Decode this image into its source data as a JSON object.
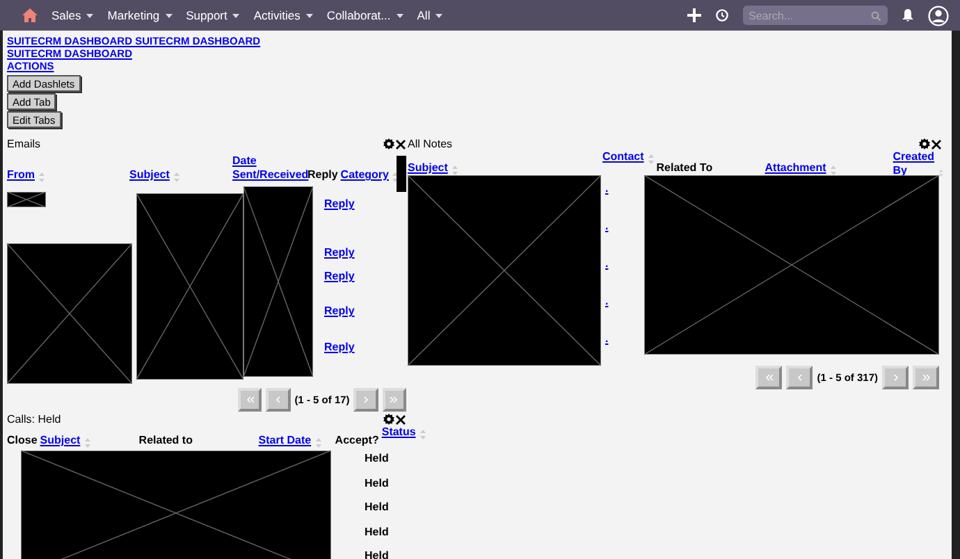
{
  "nav": {
    "items": [
      {
        "label": "Sales"
      },
      {
        "label": "Marketing"
      },
      {
        "label": "Support"
      },
      {
        "label": "Activities"
      },
      {
        "label": "Collaborat..."
      },
      {
        "label": "All"
      }
    ],
    "search": {
      "placeholder": "Search..."
    }
  },
  "breadcrumbs": [
    "SUITECRM DASHBOARD SUITECRM DASHBOARD",
    "SUITECRM DASHBOARD",
    "ACTIONS"
  ],
  "buttons": [
    "Add Dashlets",
    "Add Tab",
    "Edit Tabs"
  ],
  "emails": {
    "title": "Emails",
    "columns": [
      {
        "label": "From",
        "kind": "link"
      },
      {
        "label": "Subject",
        "kind": "link"
      },
      {
        "label": "Date Sent/Received",
        "kind": "link"
      },
      {
        "label": "Reply",
        "kind": "plain"
      },
      {
        "label": "Category",
        "kind": "link"
      }
    ],
    "rows": [
      {
        "reply": "Reply"
      },
      {
        "reply": "Reply"
      },
      {
        "reply": "Reply"
      },
      {
        "reply": "Reply"
      },
      {
        "reply": "Reply"
      }
    ],
    "pagination": "(1 - 5 of 17)"
  },
  "notes": {
    "title": "All Notes",
    "columns": [
      {
        "label": "Subject",
        "kind": "link"
      },
      {
        "label": "Contact",
        "kind": "link"
      },
      {
        "label": "Related To",
        "kind": "plain"
      },
      {
        "label": "Attachment",
        "kind": "link"
      },
      {
        "label": "Created By",
        "kind": "link"
      }
    ],
    "rows": [
      {
        "contact": "."
      },
      {
        "contact": "."
      },
      {
        "contact": "."
      },
      {
        "contact": "."
      },
      {
        "contact": "."
      }
    ],
    "pagination": "(1 - 5 of 317)"
  },
  "calls": {
    "title": "Calls: Held",
    "columns": [
      {
        "label": "Close",
        "kind": "plain"
      },
      {
        "label": "Subject",
        "kind": "link"
      },
      {
        "label": "Related to",
        "kind": "plain"
      },
      {
        "label": "Start Date",
        "kind": "link"
      },
      {
        "label": "Accept?",
        "kind": "plain"
      },
      {
        "label": "Status",
        "kind": "link"
      }
    ],
    "rows": [
      {
        "status": "Held"
      },
      {
        "status": "Held"
      },
      {
        "status": "Held"
      },
      {
        "status": "Held"
      },
      {
        "status": "Held"
      }
    ]
  }
}
